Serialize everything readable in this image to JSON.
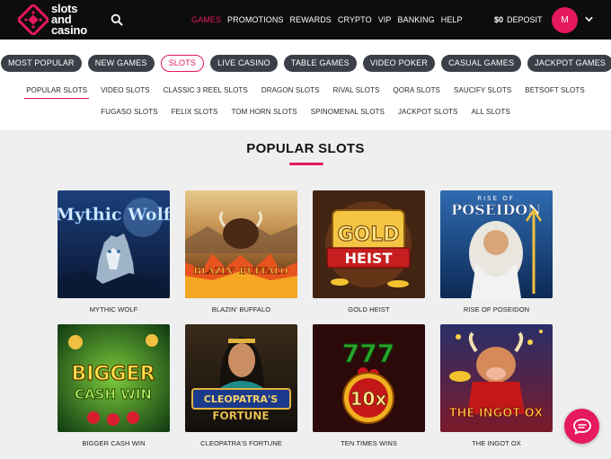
{
  "brand": {
    "line1": "slots",
    "line2": "and",
    "line3": "casino",
    "accent": "#e6185e"
  },
  "header": {
    "nav": [
      {
        "label": "GAMES",
        "active": true
      },
      {
        "label": "PROMOTIONS"
      },
      {
        "label": "REWARDS"
      },
      {
        "label": "CRYPTO"
      },
      {
        "label": "VIP"
      },
      {
        "label": "BANKING"
      },
      {
        "label": "HELP"
      }
    ],
    "balance": "$0",
    "deposit_label": "DEPOSIT",
    "avatar_initial": "M",
    "icons": {
      "search": "search-icon",
      "chevron": "chevron-down-icon"
    }
  },
  "categories": [
    {
      "label": "MOST POPULAR"
    },
    {
      "label": "NEW GAMES"
    },
    {
      "label": "SLOTS",
      "active": true
    },
    {
      "label": "LIVE CASINO"
    },
    {
      "label": "TABLE GAMES"
    },
    {
      "label": "VIDEO POKER"
    },
    {
      "label": "CASUAL GAMES"
    },
    {
      "label": "JACKPOT GAMES"
    }
  ],
  "subnav": {
    "row1": [
      "POPULAR SLOTS",
      "VIDEO SLOTS",
      "CLASSIC 3 REEL SLOTS",
      "DRAGON SLOTS",
      "RIVAL SLOTS",
      "QORA SLOTS",
      "SAUCIFY SLOTS",
      "BETSOFT SLOTS"
    ],
    "row2": [
      "FUGASO SLOTS",
      "FELIX SLOTS",
      "TOM HORN SLOTS",
      "SPINOMENAL SLOTS",
      "JACKPOT SLOTS",
      "ALL SLOTS"
    ],
    "active": "POPULAR SLOTS"
  },
  "section_title": "POPULAR SLOTS",
  "games": [
    {
      "name": "MYTHIC WOLF",
      "art": "Mythic Wolf"
    },
    {
      "name": "BLAZIN' BUFFALO",
      "art": "BLAZIN' BUFFALO"
    },
    {
      "name": "GOLD HEIST",
      "art": [
        "GOLD",
        "HEIST"
      ]
    },
    {
      "name": "RISE OF POSEIDON",
      "art": [
        "RISE OF",
        "POSEIDON"
      ]
    },
    {
      "name": "BIGGER CASH WIN",
      "art": [
        "BIGGER",
        "CASH WIN"
      ]
    },
    {
      "name": "CLEOPATRA'S FORTUNE",
      "art": [
        "CLEOPATRA'S",
        "FORTUNE"
      ]
    },
    {
      "name": "TEN TIMES WINS",
      "art": [
        "777",
        "10x"
      ]
    },
    {
      "name": "THE INGOT OX",
      "art": "THE INGOT OX"
    }
  ],
  "chat_icon": "chat-bubble-icon"
}
